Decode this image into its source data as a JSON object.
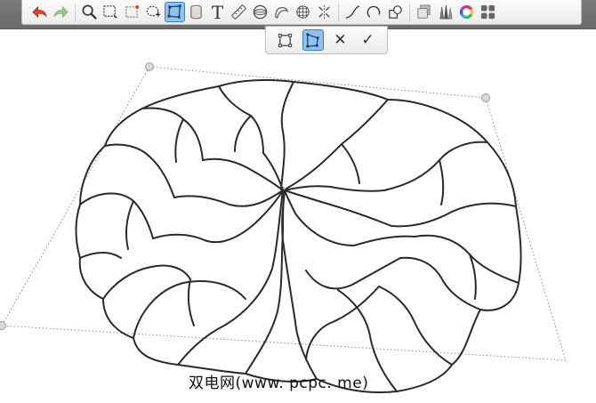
{
  "toolbar": {
    "tools": [
      {
        "icon": "undo-arrow-icon"
      },
      {
        "icon": "redo-arrow-icon"
      },
      {
        "icon": "magnify-icon"
      },
      {
        "icon": "rect-select-icon"
      },
      {
        "icon": "crop-select-icon"
      },
      {
        "icon": "lasso-select-icon"
      },
      {
        "icon": "distort-transform-icon",
        "active": true
      },
      {
        "icon": "cylinder-icon"
      },
      {
        "icon": "text-tool-icon",
        "glyph": "T"
      },
      {
        "icon": "ruler-icon"
      },
      {
        "icon": "ellipse-guide-icon"
      },
      {
        "icon": "french-curve-icon"
      },
      {
        "icon": "perspective-grid-icon"
      },
      {
        "icon": "symmetry-icon"
      },
      {
        "icon": "stroke-curve-icon"
      },
      {
        "icon": "circle-curve-icon"
      },
      {
        "icon": "shapes-icon"
      },
      {
        "icon": "layers-icon"
      },
      {
        "icon": "brush-library-icon"
      },
      {
        "icon": "color-wheel-icon"
      },
      {
        "icon": "grid-menu-icon"
      }
    ],
    "accent_color": "#8fc3ee"
  },
  "transform_bar": {
    "tools": [
      {
        "icon": "free-transform-icon"
      },
      {
        "icon": "perspective-distort-icon",
        "active": true
      },
      {
        "icon": "cancel-icon",
        "glyph": "✕"
      },
      {
        "icon": "confirm-icon",
        "glyph": "✓"
      }
    ]
  },
  "canvas": {
    "watermark_text": "双电网(www. pcpc. me)",
    "handle_color": "#d8d8d8",
    "stroke_color": "#2a2a2a"
  }
}
